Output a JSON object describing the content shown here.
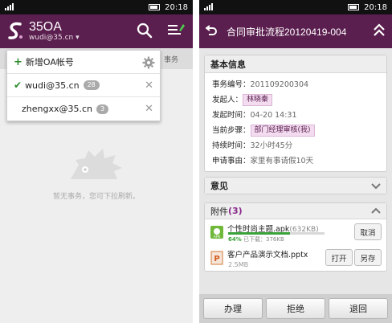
{
  "status_bar": {
    "time": "20:18"
  },
  "left": {
    "header": {
      "app_name": "35OA",
      "account": "wudi@35.cn"
    },
    "tab_partial": "事务",
    "dropdown": {
      "add_label": "新增OA帐号",
      "accounts": [
        {
          "email": "wudi@35.cn",
          "count": "28",
          "selected": true
        },
        {
          "email": "zhengxx@35.cn",
          "count": "3",
          "selected": false
        }
      ]
    },
    "empty_text": "暂无事务，您可下拉刷新。"
  },
  "right": {
    "title": "合同审批流程20120419-004",
    "basic_info": {
      "heading": "基本信息",
      "rows": [
        {
          "label": "事务编号：",
          "value": "201109200304",
          "tag": false
        },
        {
          "label": "发起人：",
          "value": "林晓秦",
          "tag": true
        },
        {
          "label": "发起时间：",
          "value": "04-20  14:31",
          "tag": false
        },
        {
          "label": "当前步骤：",
          "value": "部门经理审核(我)",
          "tag": true
        },
        {
          "label": "持续时间：",
          "value": "32小时45分",
          "tag": false
        },
        {
          "label": "申请事由：",
          "value": "家里有事请假10天",
          "tag": false
        }
      ]
    },
    "opinion": {
      "heading": "意见"
    },
    "attachments": {
      "heading": "附件",
      "count": "(3)",
      "items": [
        {
          "name": "个性时尚主题.apk",
          "size": "(632KB)",
          "progress": 0.64,
          "progress_percent": "64%",
          "downloaded": "已下载：376KB",
          "action": "取消"
        },
        {
          "name": "客户产品演示文档.pptx",
          "size": "2.5MB",
          "action_open": "打开",
          "action_save": "另存"
        }
      ]
    },
    "bottom": {
      "handle": "办理",
      "reject": "拒绝",
      "back": "退回"
    }
  },
  "colors": {
    "header_bg": "#5b1f4f",
    "accent_green": "#3aa23a",
    "tag_bg": "#f3dcf0"
  }
}
